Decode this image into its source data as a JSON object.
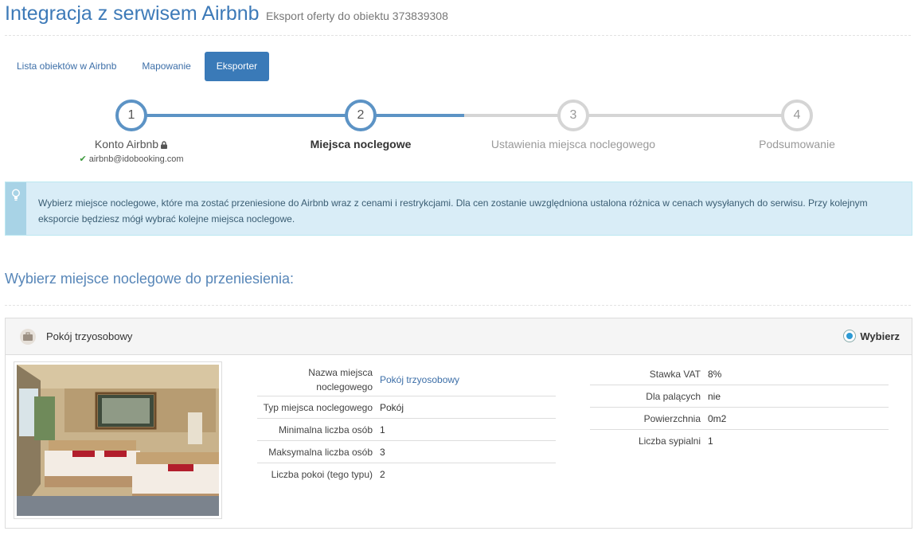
{
  "header": {
    "title": "Integracja z serwisem Airbnb",
    "subtitle": "Eksport oferty do obiektu 373839308"
  },
  "tabs": [
    {
      "label": "Lista obiektów w Airbnb",
      "active": false
    },
    {
      "label": "Mapowanie",
      "active": false
    },
    {
      "label": "Eksporter",
      "active": true
    }
  ],
  "steps": [
    {
      "number": "1",
      "label": "Konto Airbnb",
      "meta": "airbnb@idobooking.com",
      "state": "done"
    },
    {
      "number": "2",
      "label": "Miejsca noclegowe",
      "state": "current"
    },
    {
      "number": "3",
      "label": "Ustawienia miejsca noclegowego",
      "state": "todo"
    },
    {
      "number": "4",
      "label": "Podsumowanie",
      "state": "todo"
    }
  ],
  "alert": {
    "icon": "lightbulb-icon",
    "text": "Wybierz miejsce noclegowe, które ma zostać przeniesione do Airbnb wraz z cenami i restrykcjami. Dla cen zostanie uwzględniona ustalona różnica w cenach wysyłanych do serwisu. Przy kolejnym eksporcie będziesz mógł wybrać kolejne miejsca noclegowe."
  },
  "section_title": "Wybierz miejsce noclegowe do przeniesienia:",
  "room": {
    "icon": "suitcase-icon",
    "name": "Pokój trzyosobowy",
    "select_label": "Wybierz",
    "selected": true,
    "left_props": [
      {
        "label": "Nazwa miejsca noclegowego",
        "value": "Pokój trzyosobowy",
        "link": true
      },
      {
        "label": "Typ miejsca noclegowego",
        "value": "Pokój"
      },
      {
        "label": "Minimalna liczba osób",
        "value": "1"
      },
      {
        "label": "Maksymalna liczba osób",
        "value": "3"
      },
      {
        "label": "Liczba pokoi (tego typu)",
        "value": "2"
      }
    ],
    "right_props": [
      {
        "label": "Stawka VAT",
        "value": "8%"
      },
      {
        "label": "Dla palących",
        "value": "nie"
      },
      {
        "label": "Powierzchnia",
        "value": "0m2"
      },
      {
        "label": "Liczba sypialni",
        "value": "1"
      }
    ]
  },
  "colors": {
    "accent": "#3a7ab8",
    "step_done": "#5c93c5",
    "step_todo": "#d5d5d5",
    "alert_bg": "#d9edf7"
  }
}
